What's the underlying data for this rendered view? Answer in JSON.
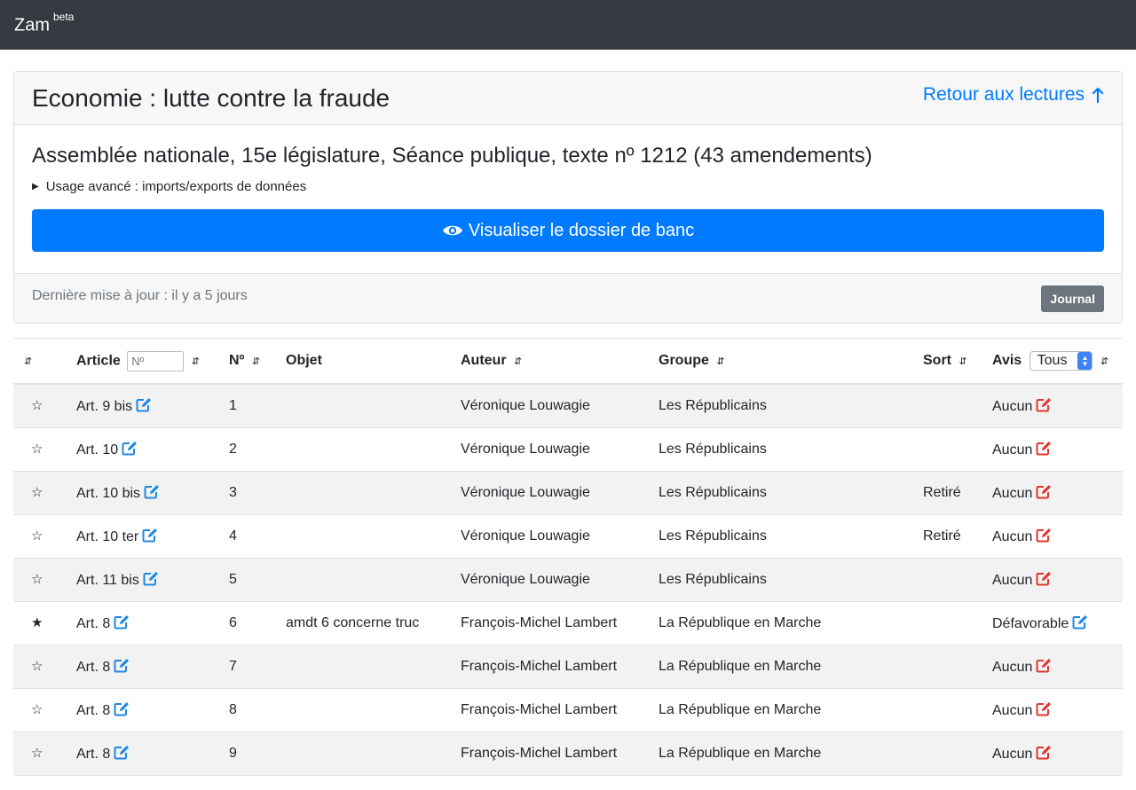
{
  "navbar": {
    "brand": "Zam",
    "badge": "beta"
  },
  "card": {
    "title": "Economie : lutte contre la fraude",
    "back_link": "Retour aux lectures",
    "subtitle": "Assemblée nationale, 15e législature, Séance publique, texte nº 1212 (43 amendements)",
    "advanced": "Usage avancé : imports/exports de données",
    "visualize_button": "Visualiser le dossier de banc",
    "last_update": "Dernière mise à jour : il y a 5 jours",
    "journal_button": "Journal"
  },
  "table": {
    "headers": {
      "sort": "⇵",
      "article": "Article",
      "article_placeholder": "Nº",
      "num": "Nº",
      "objet": "Objet",
      "auteur": "Auteur",
      "groupe": "Groupe",
      "sortcol": "Sort",
      "avis": "Avis",
      "avis_filter": "Tous"
    },
    "rows": [
      {
        "star": "☆",
        "article": "Art. 9 bis",
        "num": "1",
        "objet": "",
        "auteur": "Véronique Louwagie",
        "groupe": "Les Républicains",
        "sort": "",
        "avis": "Aucun",
        "avis_color": "#e3342f"
      },
      {
        "star": "☆",
        "article": "Art. 10",
        "num": "2",
        "objet": "",
        "auteur": "Véronique Louwagie",
        "groupe": "Les Républicains",
        "sort": "",
        "avis": "Aucun",
        "avis_color": "#e3342f"
      },
      {
        "star": "☆",
        "article": "Art. 10 bis",
        "num": "3",
        "objet": "",
        "auteur": "Véronique Louwagie",
        "groupe": "Les Républicains",
        "sort": "Retiré",
        "avis": "Aucun",
        "avis_color": "#e3342f"
      },
      {
        "star": "☆",
        "article": "Art. 10 ter",
        "num": "4",
        "objet": "",
        "auteur": "Véronique Louwagie",
        "groupe": "Les Républicains",
        "sort": "Retiré",
        "avis": "Aucun",
        "avis_color": "#e3342f"
      },
      {
        "star": "☆",
        "article": "Art. 11 bis",
        "num": "5",
        "objet": "",
        "auteur": "Véronique Louwagie",
        "groupe": "Les Républicains",
        "sort": "",
        "avis": "Aucun",
        "avis_color": "#e3342f"
      },
      {
        "star": "★",
        "article": "Art. 8",
        "num": "6",
        "objet": "amdt 6 concerne truc",
        "auteur": "François-Michel Lambert",
        "groupe": "La République en Marche",
        "sort": "",
        "avis": "Défavorable",
        "avis_color": "#1e88e5"
      },
      {
        "star": "☆",
        "article": "Art. 8",
        "num": "7",
        "objet": "",
        "auteur": "François-Michel Lambert",
        "groupe": "La République en Marche",
        "sort": "",
        "avis": "Aucun",
        "avis_color": "#e3342f"
      },
      {
        "star": "☆",
        "article": "Art. 8",
        "num": "8",
        "objet": "",
        "auteur": "François-Michel Lambert",
        "groupe": "La République en Marche",
        "sort": "",
        "avis": "Aucun",
        "avis_color": "#e3342f"
      },
      {
        "star": "☆",
        "article": "Art. 8",
        "num": "9",
        "objet": "",
        "auteur": "François-Michel Lambert",
        "groupe": "La République en Marche",
        "sort": "",
        "avis": "Aucun",
        "avis_color": "#e3342f"
      }
    ]
  },
  "colors": {
    "navbar": "#343a40",
    "primary": "#007bff",
    "secondary": "#6c757d",
    "edit_article": "#1e88e5"
  }
}
